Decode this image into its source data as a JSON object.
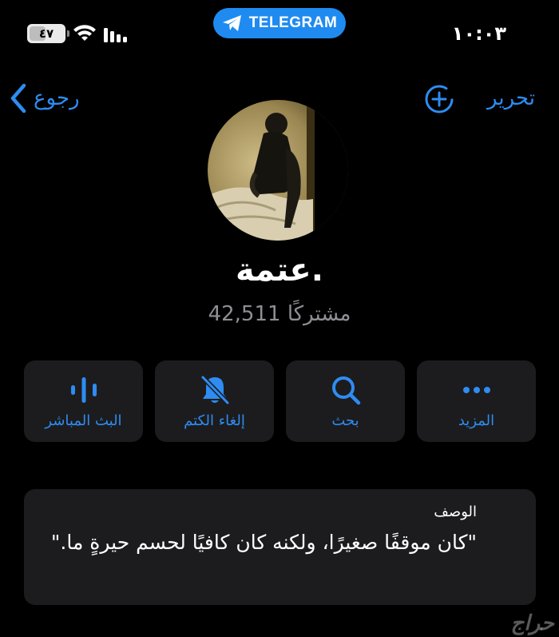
{
  "status_bar": {
    "time": "١٠:٠٣",
    "battery": "٤٧",
    "battery_level": 0.47,
    "app_pill": "TELEGRAM",
    "icons": [
      "signal-icon",
      "wifi-icon",
      "battery-icon"
    ]
  },
  "nav": {
    "back_label": "رجوع",
    "edit_label": "تحرير"
  },
  "channel": {
    "name": "عتمة.",
    "subscribers": "42,511 مشتركًا"
  },
  "actions": [
    {
      "label": "المزيد",
      "icon": "more-icon"
    },
    {
      "label": "بحث",
      "icon": "search-icon"
    },
    {
      "label": "إلغاء الكتم",
      "icon": "bell-slash-icon"
    },
    {
      "label": "البث المباشر",
      "icon": "live-stream-icon"
    }
  ],
  "description": {
    "label": "الوصف",
    "text": "\"كان موقفًا صغيرًا، ولكنه كان كافيًا لحسم حيرةٍ ما.\""
  },
  "watermark": "حراج",
  "colors": {
    "accent": "#2e8cf2",
    "pill": "#1f8bf0",
    "card": "#1c1c1e",
    "secondary_text": "#8e8e93",
    "background": "#000000"
  }
}
